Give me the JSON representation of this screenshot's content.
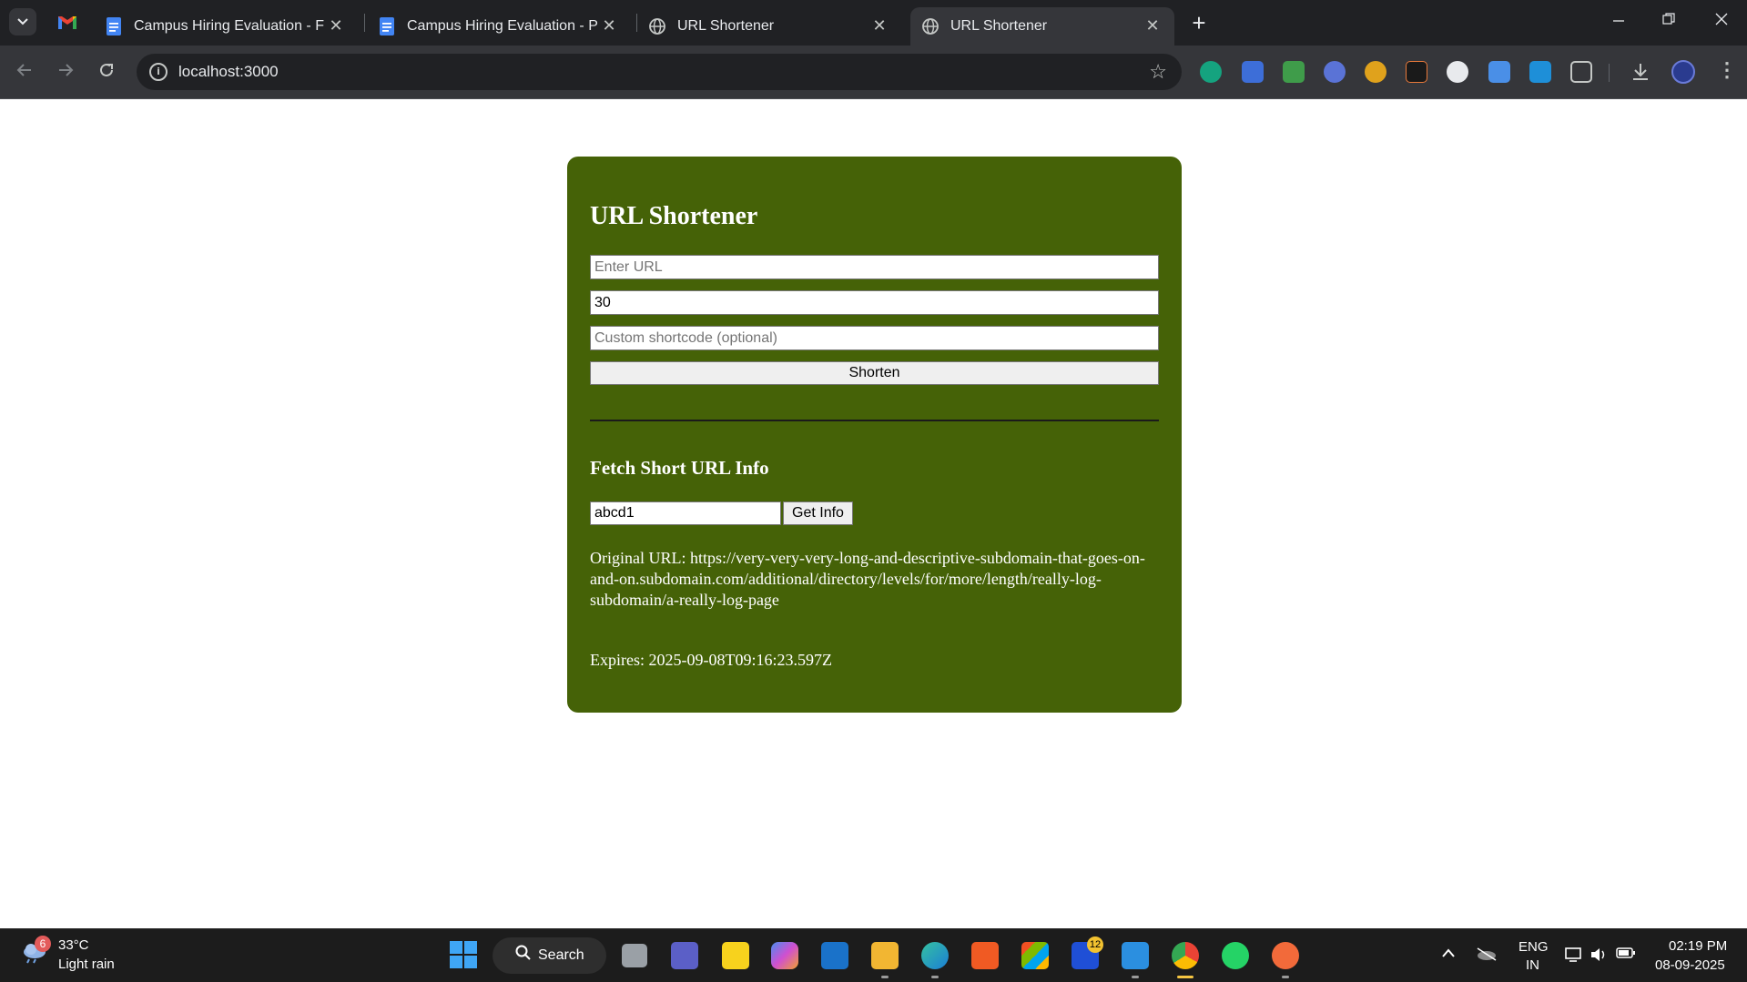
{
  "browser": {
    "tabs": [
      {
        "title": "Campus Hiring Evaluation - Full",
        "icon": "google-docs-icon"
      },
      {
        "title": "Campus Hiring Evaluation - Pre",
        "icon": "google-docs-icon"
      },
      {
        "title": "URL Shortener",
        "icon": "globe-icon"
      },
      {
        "title": "URL Shortener",
        "icon": "globe-icon",
        "active": true
      }
    ],
    "close_glyph": "✕",
    "new_tab_glyph": "+",
    "address": "localhost:3000",
    "colors": {
      "tabstrip": "#202124",
      "toolbar": "#35363a"
    }
  },
  "page": {
    "title": "URL Shortener",
    "url_input": {
      "placeholder": "Enter URL",
      "value": ""
    },
    "validity_input": {
      "value": "30"
    },
    "shortcode_input": {
      "placeholder": "Custom shortcode (optional)",
      "value": ""
    },
    "shorten_button": "Shorten",
    "fetch_heading": "Fetch Short URL Info",
    "code_input": {
      "value": "abcd1"
    },
    "get_info_button": "Get Info",
    "original_url": "Original URL: https://very-very-very-long-and-descriptive-subdomain-that-goes-on-and-on.subdomain.com/additional/directory/levels/for/more/length/really-log-subdomain/a-really-log-page",
    "expires": "Expires: 2025-09-08T09:16:23.597Z",
    "colors": {
      "card": "#456207",
      "text": "#ffffff"
    }
  },
  "taskbar": {
    "weather": {
      "badge": "6",
      "temp": "33°C",
      "condition": "Light rain"
    },
    "search_label": "Search",
    "store_badge": "12",
    "language": {
      "line1": "ENG",
      "line2": "IN"
    },
    "clock": {
      "time": "02:19 PM",
      "date": "08-09-2025"
    }
  }
}
